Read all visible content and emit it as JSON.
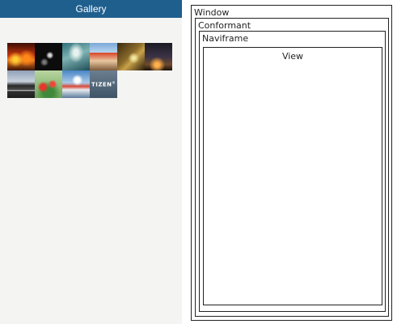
{
  "app": {
    "title": "Gallery",
    "thumbnails": [
      {
        "icon": "sunset-city-photo"
      },
      {
        "icon": "dark-abstract-photo"
      },
      {
        "icon": "teal-water-photo"
      },
      {
        "icon": "red-building-photo"
      },
      {
        "icon": "golden-field-photo"
      },
      {
        "icon": "dusk-sky-photo"
      },
      {
        "icon": "road-photo"
      },
      {
        "icon": "red-flowers-photo"
      },
      {
        "icon": "boat-sky-photo"
      },
      {
        "icon": "tizen-logo-tile",
        "label": "TIZEN",
        "mark": "®"
      }
    ]
  },
  "diagram": {
    "window": "Window",
    "conformant": "Conformant",
    "naviframe": "Naviframe",
    "view": "View"
  },
  "colors": {
    "titlebar": "#1f5f8e",
    "panel_bg": "#f4f4f2",
    "border": "#222222"
  }
}
